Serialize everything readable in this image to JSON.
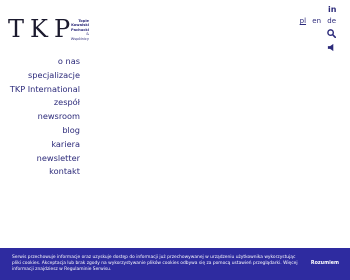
{
  "logo": {
    "mark": "TKP",
    "sub": [
      "Topie",
      "Kowalski",
      "Pachucki",
      "& Wspólnicy"
    ]
  },
  "header": {
    "linkedin_glyph": "in",
    "languages": [
      {
        "code": "pl",
        "active": true
      },
      {
        "code": "en",
        "active": false
      },
      {
        "code": "de",
        "active": false
      }
    ]
  },
  "icons": {
    "linkedin": "linkedin-icon",
    "search": "search-icon",
    "audio": "speaker-icon"
  },
  "menu": [
    {
      "label": "o nas"
    },
    {
      "label": "specjalizacje"
    },
    {
      "label": "TKP International"
    },
    {
      "label": "zespół"
    },
    {
      "label": "newsroom"
    },
    {
      "label": "blog"
    },
    {
      "label": "kariera"
    },
    {
      "label": "newsletter"
    },
    {
      "label": "kontakt"
    }
  ],
  "cookie_banner": {
    "text": "Serwis przechowuje informacje oraz uzyskuje dostęp do informacji już przechowywanej w urządzeniu użytkownika wykorzystując pliki cookies. Akceptacja lub brak zgody na wykorzystywanie plików cookies odbywa się za pomocą ustawień przeglądarki. Więcej informacji znajdziesz w Regulaminie Serwisu.",
    "accept_label": "Rozumiem"
  },
  "colors": {
    "brand": "#2c2a7a",
    "banner": "#2e2ba0",
    "background": "#ffffff"
  }
}
